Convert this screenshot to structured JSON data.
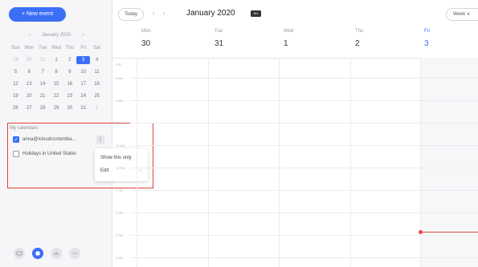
{
  "sidebar": {
    "new_event_label": "+ New event",
    "mini_calendar": {
      "prev": "‹",
      "month_label": "January 2020",
      "next": "›",
      "weekdays": [
        "Sun",
        "Mon",
        "Tue",
        "Wed",
        "Thu",
        "Fri",
        "Sat"
      ],
      "weeks": [
        [
          "29",
          "30",
          "31",
          "1",
          "2",
          "3",
          "4"
        ],
        [
          "5",
          "6",
          "7",
          "8",
          "9",
          "10",
          "11"
        ],
        [
          "12",
          "13",
          "14",
          "15",
          "16",
          "17",
          "18"
        ],
        [
          "19",
          "20",
          "21",
          "22",
          "23",
          "24",
          "25"
        ],
        [
          "26",
          "27",
          "28",
          "29",
          "30",
          "31",
          "1"
        ]
      ],
      "selected_day": "3"
    },
    "my_calendars_title": "My calendars",
    "calendars": [
      {
        "label": "anna@icloudcontentba...",
        "checked": true
      },
      {
        "label": "Holidays in United States",
        "checked": false
      }
    ],
    "more_label": "⋮",
    "context_menu": {
      "show_only": "Show this only",
      "edit": "Edit",
      "edit_arrow": "›"
    },
    "dock_icons": [
      "inbox-icon",
      "calendar-icon",
      "chart-icon",
      "more-icon"
    ]
  },
  "toolbar": {
    "today_label": "Today",
    "prev": "‹",
    "next": "›",
    "month_title": "January 2020",
    "badge": "W1",
    "view_label": "Week ∨"
  },
  "days": [
    {
      "name": "Mon",
      "num": "30"
    },
    {
      "name": "Tue",
      "num": "31"
    },
    {
      "name": "Wed",
      "num": "1"
    },
    {
      "name": "Thu",
      "num": "2"
    },
    {
      "name": "Fri",
      "num": "3"
    }
  ],
  "hours": [
    "PST",
    "8 AM",
    "9 AM",
    "10 AM",
    "11 AM",
    "12 PM",
    "1 PM",
    "2 PM",
    "3 PM",
    "4 PM"
  ],
  "colors": {
    "accent": "#3b6ff5",
    "highlight": "#e0413a",
    "now": "#e8483f"
  }
}
